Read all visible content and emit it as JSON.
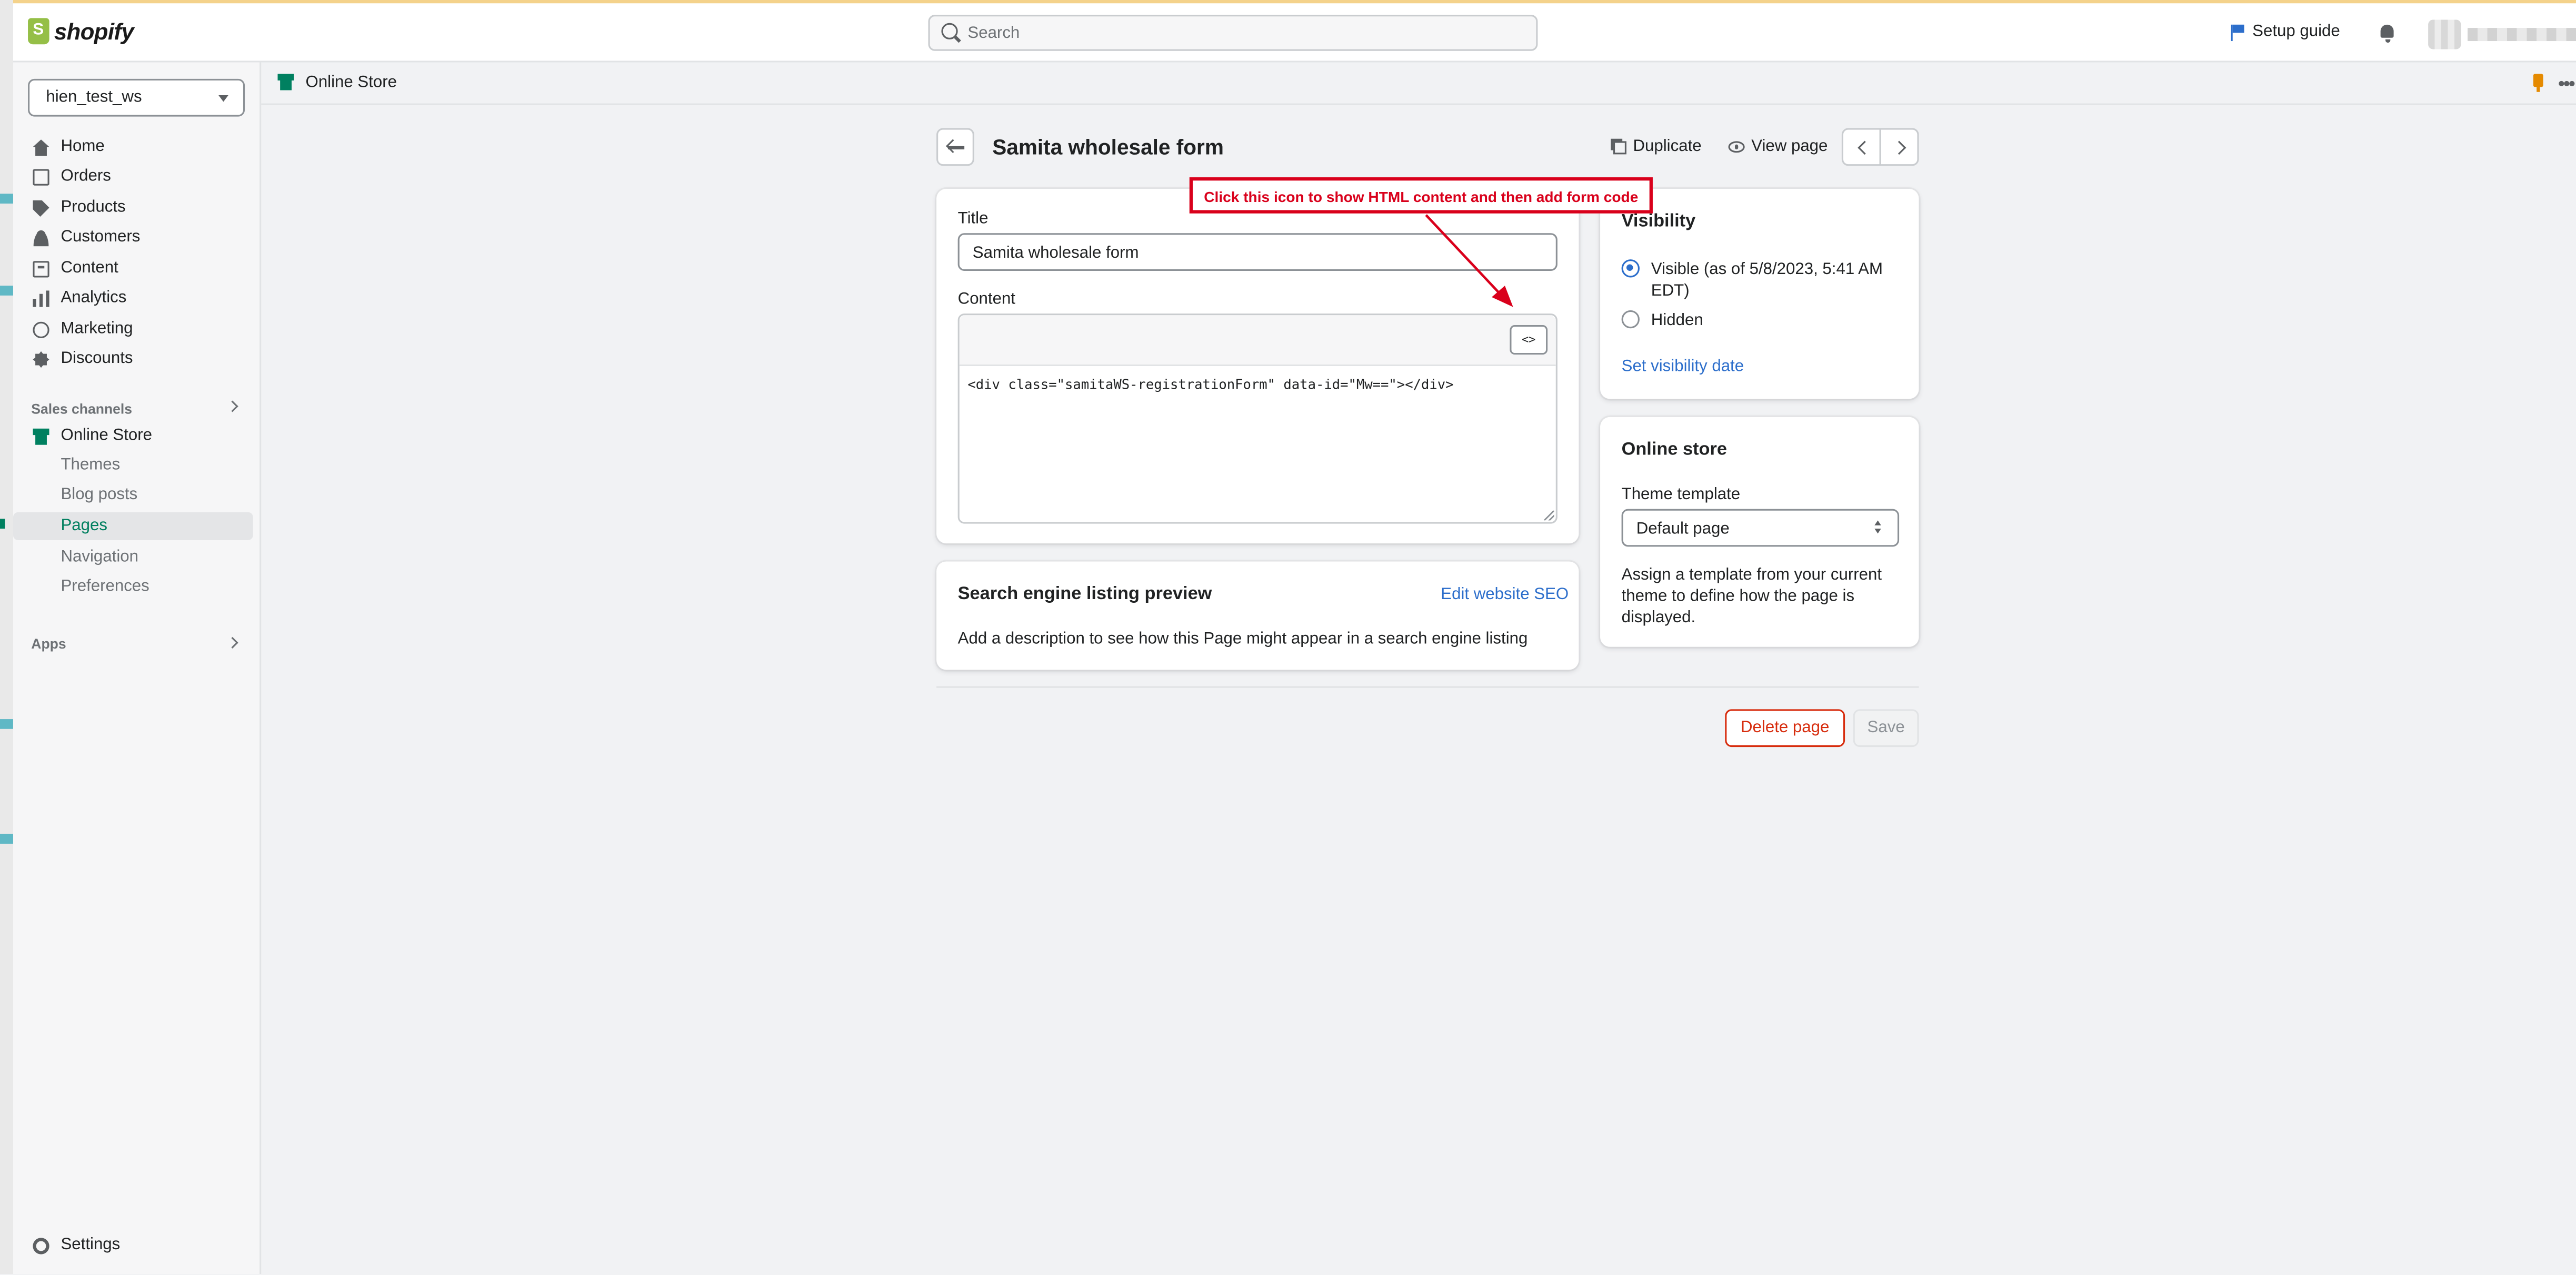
{
  "topbar": {
    "logo_text": "shopify",
    "search_placeholder": "Search",
    "setup_guide": "Setup guide"
  },
  "sidebar": {
    "store_name": "hien_test_ws",
    "main_items": [
      {
        "label": "Home",
        "icon": "home-icon"
      },
      {
        "label": "Orders",
        "icon": "orders-icon"
      },
      {
        "label": "Products",
        "icon": "tag-icon"
      },
      {
        "label": "Customers",
        "icon": "person-icon"
      },
      {
        "label": "Content",
        "icon": "content-icon"
      },
      {
        "label": "Analytics",
        "icon": "bar-chart-icon"
      },
      {
        "label": "Marketing",
        "icon": "target-icon"
      },
      {
        "label": "Discounts",
        "icon": "discount-icon"
      }
    ],
    "sales_channels_label": "Sales channels",
    "online_store_label": "Online Store",
    "online_store_subitems": [
      "Themes",
      "Blog posts",
      "Pages",
      "Navigation",
      "Preferences"
    ],
    "active_subitem": "Pages",
    "apps_label": "Apps",
    "settings_label": "Settings"
  },
  "breadcrumb": {
    "label": "Online Store"
  },
  "page": {
    "title": "Samita wholesale form",
    "duplicate_label": "Duplicate",
    "view_page_label": "View page"
  },
  "main_card": {
    "title_label": "Title",
    "title_value": "Samita wholesale form",
    "content_label": "Content",
    "html_toggle_glyph": "<>",
    "code": "<div class=\"samitaWS-registrationForm\" data-id=\"Mw==\"></div>"
  },
  "seo_card": {
    "heading": "Search engine listing preview",
    "edit_link": "Edit website SEO",
    "description": "Add a description to see how this Page might appear in a search engine listing"
  },
  "visibility_card": {
    "heading": "Visibility",
    "visible_line1": "Visible (as of 5/8/2023, 5:41 AM",
    "visible_line2": "EDT)",
    "hidden_label": "Hidden",
    "set_date_link": "Set visibility date",
    "selected": "Visible"
  },
  "online_store_card": {
    "heading": "Online store",
    "template_label": "Theme template",
    "template_value": "Default page",
    "help_line1": "Assign a template from your current",
    "help_line2": "theme to define how the page is",
    "help_line3": "displayed."
  },
  "footer": {
    "delete_label": "Delete page",
    "save_label": "Save"
  },
  "annotation": {
    "text": "Click this icon to show HTML content and then add form code",
    "color": "#d9001b"
  },
  "colors": {
    "accent_blue": "#2c6ecb",
    "brand_green": "#008060",
    "danger_red": "#d72c0d"
  }
}
